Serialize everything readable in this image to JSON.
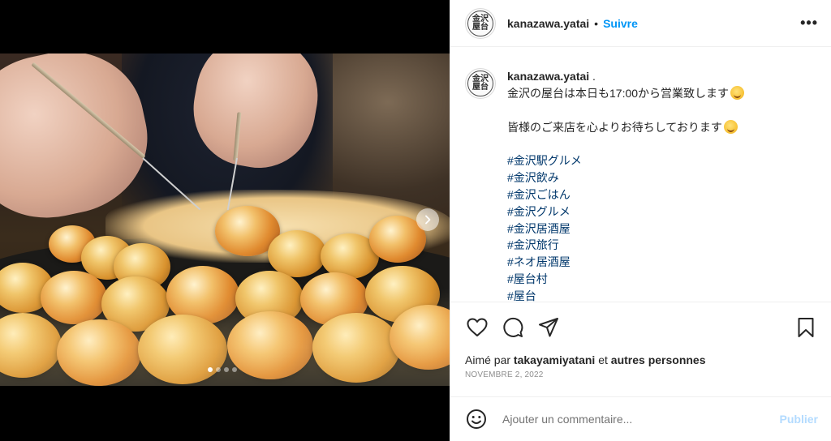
{
  "media": {
    "carousel_dots": 4,
    "active_dot": 0
  },
  "header": {
    "avatar_text_top": "金沢",
    "avatar_text_bottom": "屋台",
    "username": "kanazawa.yatai",
    "separator": "•",
    "follow_label": "Suivre",
    "more_label": "•••"
  },
  "caption": {
    "username": "kanazawa.yatai",
    "suffix": " .",
    "line1": "金沢の屋台は本日も17:00から営業致します",
    "line2": "皆様のご来店を心よりお待ちしております",
    "hashtags": [
      "#金沢駅グルメ",
      "#金沢飲み",
      "#金沢ごはん",
      "#金沢グルメ",
      "#金沢居酒屋",
      "#金沢旅行",
      "#ネオ居酒屋",
      "#屋台村",
      "#屋台"
    ]
  },
  "actions": {
    "liked_prefix": "Aimé par ",
    "liked_user": "takayamiyatani",
    "liked_mid": " et ",
    "liked_others": "autres personnes",
    "date": "NOVEMBRE 2, 2022"
  },
  "composer": {
    "placeholder": "Ajouter un commentaire...",
    "publish_label": "Publier"
  },
  "colors": {
    "accent": "#0095f6",
    "hashtag": "#00376b",
    "publish_disabled": "#b3dbff"
  }
}
